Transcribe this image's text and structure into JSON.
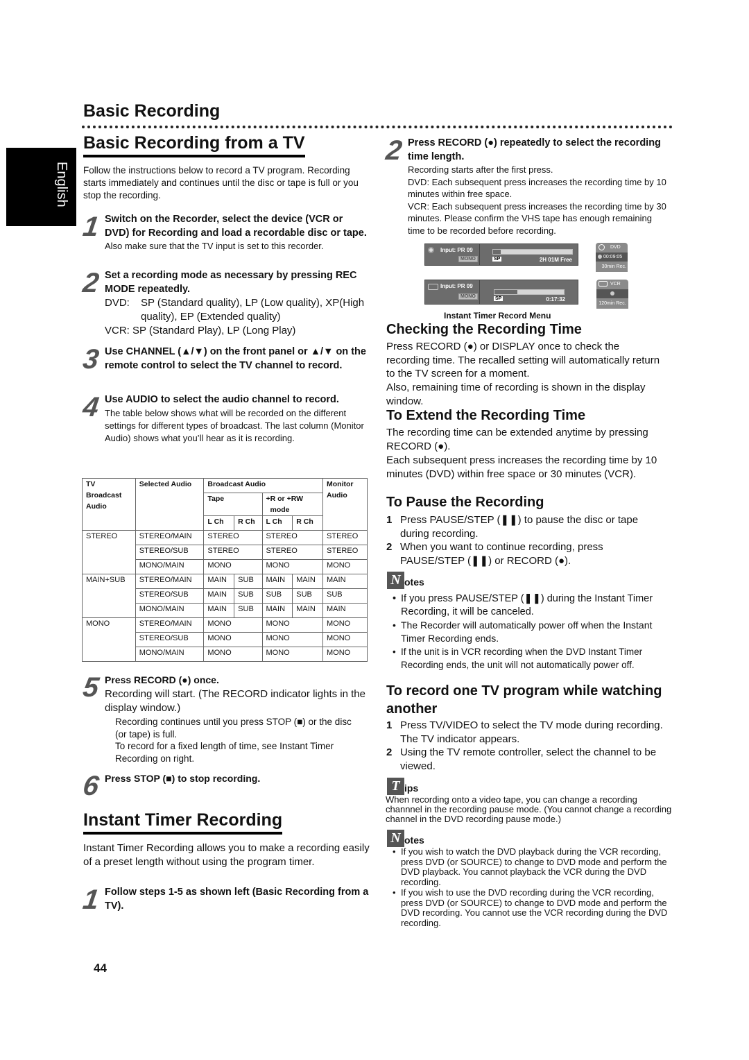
{
  "page": {
    "section_title": "Basic Recording",
    "language_tab": "English",
    "page_number": "44"
  },
  "left": {
    "title": "Basic Recording from a TV",
    "intro": "Follow the instructions below to record a TV program. Recording starts immediately and continues until the disc or tape is full or you stop the recording.",
    "steps": [
      {
        "num": "1",
        "heading": "Switch on the Recorder, select the device (VCR or DVD) for Recording and load a recordable disc or tape.",
        "body": "Also make sure that the TV input is set to this recorder."
      },
      {
        "num": "2",
        "heading": "Set a recording mode as necessary by pressing REC MODE repeatedly.",
        "dvd_label": "DVD:",
        "dvd_text": "SP (Standard quality), LP (Low quality), XP(High quality), EP (Extended quality)",
        "vcr_text": "VCR: SP (Standard Play), LP (Long Play)"
      },
      {
        "num": "3",
        "heading": "Use CHANNEL (▲/▼) on the front panel or ▲/▼ on the remote control to select the TV channel to record."
      },
      {
        "num": "4",
        "heading": "Use AUDIO to select the audio channel to record.",
        "body": "The table below shows what will be recorded on the different settings for different types of broadcast. The last column (Monitor Audio) shows what you’ll hear as it is recording."
      },
      {
        "num": "5",
        "heading": "Press RECORD (●) once.",
        "body": "Recording will start. (The RECORD indicator lights in the display window.)",
        "sub1": "Recording continues until you press STOP (■) or the disc (or tape) is full.",
        "sub2": "To record for a fixed length of time, see Instant Timer Recording on right."
      },
      {
        "num": "6",
        "heading": "Press STOP (■) to stop recording."
      }
    ],
    "table": {
      "headers": {
        "tv_broadcast": "TV Broadcast Audio",
        "tv_line1": "TV",
        "tv_line2": "Broadcast",
        "tv_line3": "Audio",
        "selected_audio": "Selected Audio",
        "broadcast_audio": "Broadcast Audio",
        "tape": "Tape",
        "r_rw": "+R or +RW",
        "r_rw_mode": "mode",
        "lch": "L Ch",
        "rch": "R Ch",
        "monitor": "Monitor",
        "monitor2": "Audio"
      },
      "groups": [
        {
          "broadcast": "STEREO",
          "rows": [
            {
              "selected": "STEREO/MAIN",
              "tape": "STEREO",
              "rw": "STEREO",
              "monitor": "STEREO"
            },
            {
              "selected": "STEREO/SUB",
              "tape": "STEREO",
              "rw": "STEREO",
              "monitor": "STEREO"
            },
            {
              "selected": "MONO/MAIN",
              "tape": "MONO",
              "rw": "MONO",
              "monitor": "MONO"
            }
          ]
        },
        {
          "broadcast": "MAIN+SUB",
          "rows": [
            {
              "selected": "STEREO/MAIN",
              "tape_l": "MAIN",
              "tape_r": "SUB",
              "rw_l": "MAIN",
              "rw_r": "MAIN",
              "monitor": "MAIN"
            },
            {
              "selected": "STEREO/SUB",
              "tape_l": "MAIN",
              "tape_r": "SUB",
              "rw_l": "SUB",
              "rw_r": "SUB",
              "monitor": "SUB"
            },
            {
              "selected": "MONO/MAIN",
              "tape_l": "MAIN",
              "tape_r": "SUB",
              "rw_l": "MAIN",
              "rw_r": "MAIN",
              "monitor": "MAIN"
            }
          ]
        },
        {
          "broadcast": "MONO",
          "rows": [
            {
              "selected": "STEREO/MAIN",
              "tape": "MONO",
              "rw": "MONO",
              "monitor": "MONO"
            },
            {
              "selected": "STEREO/SUB",
              "tape": "MONO",
              "rw": "MONO",
              "monitor": "MONO"
            },
            {
              "selected": "MONO/MAIN",
              "tape": "MONO",
              "rw": "MONO",
              "monitor": "MONO"
            }
          ]
        }
      ]
    },
    "instant": {
      "title": "Instant Timer Recording",
      "intro": "Instant Timer Recording allows you to make a recording easily of a preset length without using the program timer.",
      "step1_num": "1",
      "step1": "Follow steps 1-5 as shown left (Basic Recording from a TV)."
    }
  },
  "right": {
    "step2": {
      "num": "2",
      "heading": "Press RECORD (●) repeatedly to select the recording time length.",
      "lines": [
        "Recording starts after the first press.",
        "DVD: Each subsequent press increases the recording time by 10 minutes within free space.",
        "VCR: Each subsequent press increases the recording time by 30 minutes. Please confirm the VHS tape has enough remaining time to be recorded before recording."
      ]
    },
    "osd": {
      "caption": "Instant Timer Record Menu",
      "dvd": {
        "input": "Input:  PR 09",
        "audio": "MONO",
        "mode": "SP",
        "status": "2H  01M  Free",
        "progress": 0.1,
        "badge_title": "DVD",
        "badge_time": "00:09:05",
        "badge_rec": "30min Rec."
      },
      "vcr": {
        "input": "Input:  PR 09",
        "audio": "MONO",
        "mode": "SP",
        "status": "0:17:32",
        "progress": 0.33,
        "badge_title": "VCR",
        "badge_rec": "120min Rec."
      }
    },
    "checking": {
      "title": "Checking the Recording Time",
      "p1": "Press RECORD (●) or DISPLAY once to check the recording time. The recalled setting will automatically return to the TV screen for a moment.",
      "p2": "Also, remaining time of recording is shown in the display window."
    },
    "extend": {
      "title": "To Extend the Recording Time",
      "p1": "The recording time can be extended anytime by pressing RECORD (●).",
      "p2": "Each subsequent press increases the recording time by 10 minutes (DVD) within free space or 30 minutes (VCR)."
    },
    "pause": {
      "title": "To Pause the Recording",
      "items": [
        {
          "n": "1",
          "text": "Press PAUSE/STEP (❚❚) to pause the disc or tape during recording."
        },
        {
          "n": "2",
          "text": "When you want to continue recording, press PAUSE/STEP (❚❚) or RECORD (●)."
        }
      ]
    },
    "notes1": {
      "icon": "N",
      "label": "otes",
      "items": [
        "If you press PAUSE/STEP (❚❚) during the Instant Timer Recording, it will be canceled.",
        "The Recorder will automatically power off when the Instant Timer Recording ends.",
        "If the unit is in VCR recording when the DVD Instant Timer Recording ends, the unit will not automatically power off."
      ]
    },
    "watch": {
      "title": "To record one TV program while watching another",
      "items": [
        {
          "n": "1",
          "text": "Press TV/VIDEO to select the TV mode during recording. The TV indicator appears."
        },
        {
          "n": "2",
          "text": "Using the TV remote controller, select the channel to be viewed."
        }
      ]
    },
    "tips": {
      "icon": "T",
      "label": "ips",
      "text": "When recording onto a video tape, you can change a recording channnel in the recording pause mode. (You cannot change a recording channel in the DVD recording pause mode.)"
    },
    "notes2": {
      "icon": "N",
      "label": "otes",
      "items": [
        "If you wish to watch the DVD playback during the VCR recording, press DVD (or SOURCE) to change to DVD mode and perform the DVD playback. You cannot playback the VCR during the DVD recording.",
        "If you wish to use the DVD recording during the VCR recording, press DVD (or SOURCE) to change to DVD mode and perform the DVD recording. You cannot use the VCR recording during the DVD recording."
      ]
    }
  }
}
